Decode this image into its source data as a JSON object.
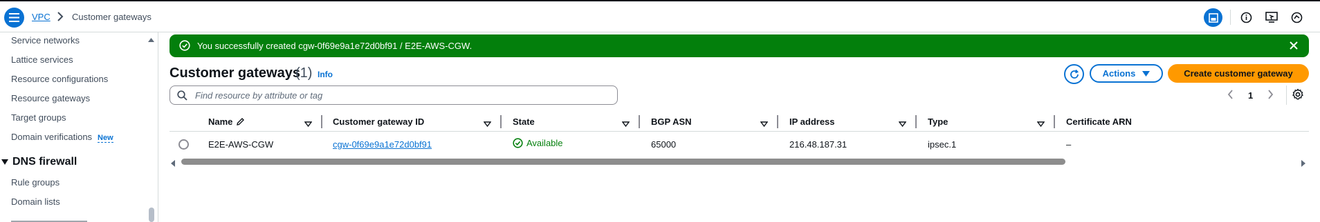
{
  "breadcrumb": {
    "parent": "VPC",
    "current": "Customer gateways"
  },
  "sidebar": {
    "items": [
      {
        "label": "Service networks"
      },
      {
        "label": "Lattice services"
      },
      {
        "label": "Resource configurations"
      },
      {
        "label": "Resource gateways"
      },
      {
        "label": "Target groups"
      },
      {
        "label": "Domain verifications",
        "badge": "New"
      }
    ],
    "section": {
      "title": "DNS firewall",
      "items": [
        {
          "label": "Rule groups"
        },
        {
          "label": "Domain lists"
        }
      ]
    }
  },
  "flash": {
    "message": "You successfully created cgw-0f69e9a1e72d0bf91 / E2E-AWS-CGW.",
    "color": "#037f0c"
  },
  "header": {
    "title": "Customer gateways",
    "count": "(1)",
    "info": "Info",
    "actions_label": "Actions",
    "create_label": "Create customer gateway"
  },
  "search": {
    "placeholder": "Find resource by attribute or tag",
    "value": ""
  },
  "pagination": {
    "current_page": "1"
  },
  "table": {
    "columns": [
      "Name",
      "Customer gateway ID",
      "State",
      "BGP ASN",
      "IP address",
      "Type",
      "Certificate ARN"
    ],
    "rows": [
      {
        "name": "E2E-AWS-CGW",
        "id": "cgw-0f69e9a1e72d0bf91",
        "state": "Available",
        "bgp_asn": "65000",
        "ip": "216.48.187.31",
        "type": "ipsec.1",
        "cert_arn": "–"
      }
    ]
  },
  "colors": {
    "accent": "#0972d3",
    "success": "#037f0c",
    "primary_button": "#ff9900"
  }
}
